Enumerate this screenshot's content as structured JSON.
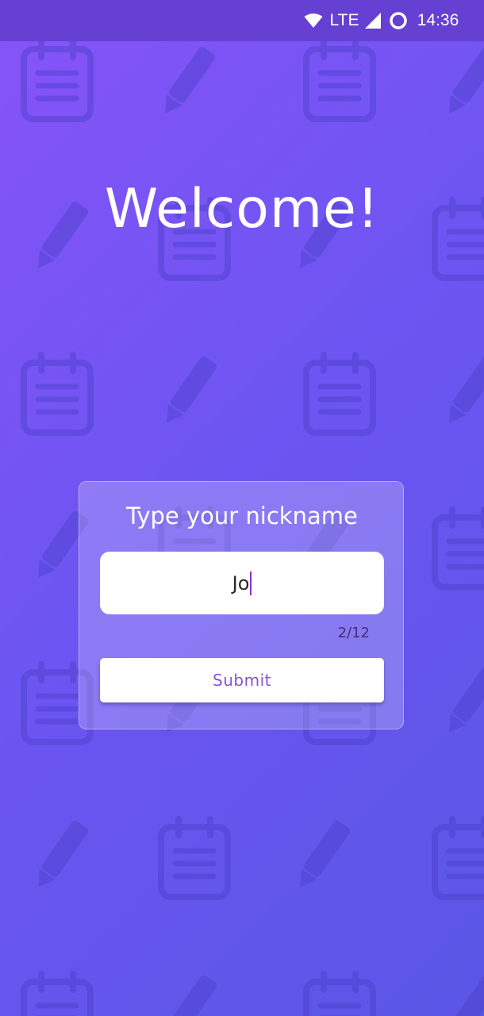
{
  "status_bar": {
    "network": "LTE",
    "time": "14:36",
    "icons": [
      "wifi-icon",
      "signal-icon",
      "sync-circle-icon"
    ]
  },
  "title": "Welcome!",
  "nickname_card": {
    "heading": "Type your nickname",
    "input_value": "Jo",
    "char_counter": "2/12",
    "submit_label": "Submit"
  },
  "background_pattern": {
    "icons": [
      "notepad-icon",
      "pencil-icon"
    ]
  },
  "colors": {
    "gradient_start": "#8754f8",
    "gradient_end": "#5a56e6",
    "status_bar": "#6640d2",
    "accent_text": "#8a52d6",
    "cursor": "#8a33c8"
  }
}
